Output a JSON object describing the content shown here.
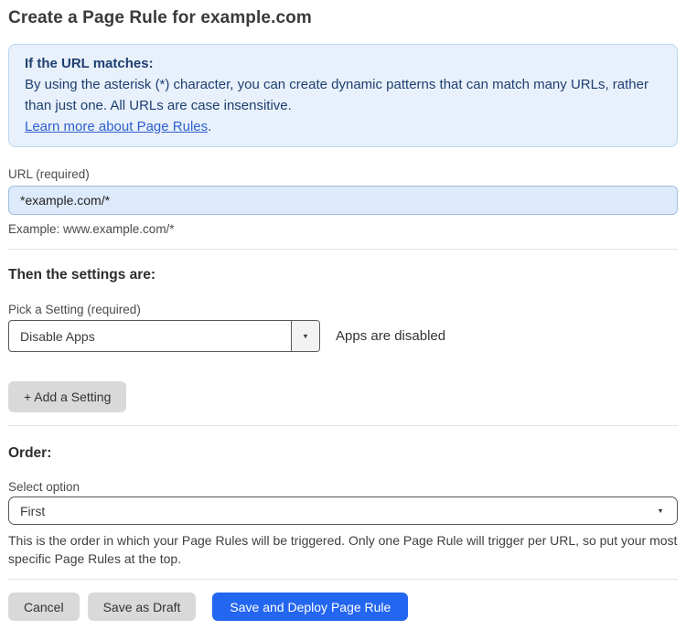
{
  "page": {
    "title": "Create a Page Rule for example.com"
  },
  "info_box": {
    "heading": "If the URL matches:",
    "body": "By using the asterisk (*) character, you can create dynamic patterns that can match many URLs, rather than just one. All URLs are case insensitive.",
    "link_label": "Learn more about Page Rules",
    "link_suffix": "."
  },
  "url_field": {
    "label": "URL (required)",
    "value": "*example.com/*",
    "helper": "Example: www.example.com/*"
  },
  "settings_section": {
    "heading": "Then the settings are:",
    "setting_label": "Pick a Setting (required)",
    "setting_value": "Disable Apps",
    "setting_status": "Apps are disabled",
    "add_button_label": "+ Add a Setting"
  },
  "order_section": {
    "heading": "Order:",
    "label": "Select option",
    "value": "First",
    "helper": "This is the order in which your Page Rules will be triggered. Only one Page Rule will trigger per URL, so put your most specific Page Rules at the top."
  },
  "footer": {
    "cancel_label": "Cancel",
    "save_draft_label": "Save as Draft",
    "save_deploy_label": "Save and Deploy Page Rule"
  },
  "icons": {
    "dropdown_caret": "▼"
  },
  "colors": {
    "accent_blue": "#2366f0",
    "info_box_bg": "#e8f1fb",
    "info_box_border": "#b9d5f1",
    "info_text": "#1e3e70",
    "link_blue": "#2e5fd0",
    "url_input_bg": "#ddeafb",
    "gray_button_bg": "#d9d9d9"
  }
}
